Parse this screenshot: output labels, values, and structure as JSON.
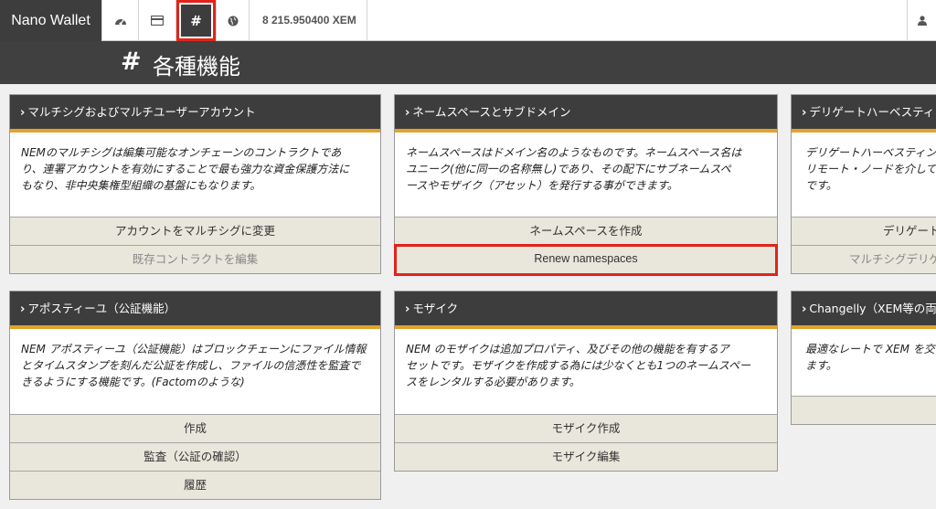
{
  "nav": {
    "brand": "Nano Wallet",
    "active_symbol": "#",
    "balance": "8 215.950400 XEM",
    "icons": [
      "dashboard-icon",
      "card-icon",
      "hash-icon",
      "globe-icon",
      "user-icon"
    ]
  },
  "page": {
    "title": "各種機能"
  },
  "panels": [
    {
      "title": "マルチシグおよびマルチユーザーアカウント",
      "lines": [
        "NEMのマルチシグは編集可能なオンチェーンのコントラクトであ",
        "り、連署アカウントを有効にすることで最も強力な資金保護方法に",
        "もなり、非中央集権型組織の基盤にもなります。"
      ],
      "buttons": [
        "アカウントをマルチシグに変更",
        "既存コントラクトを編集"
      ]
    },
    {
      "title": "ネームスペースとサブドメイン",
      "lines": [
        "ネームスペースはドメイン名のようなものです。ネームスペース名は",
        "ユニーク(他に同一の名称無し)であり、その配下にサブネームスペ",
        "ースやモザイク（アセット）を発行する事ができます。"
      ],
      "buttons": [
        "ネームスペースを作成",
        "Renew namespaces"
      ]
    },
    {
      "title": "デリゲートハーベスティング",
      "lines": [
        "デリゲートハーベスティングは",
        "リモート・ノードを介して「",
        "です。"
      ],
      "buttons": [
        "デリゲートア",
        "マルチシグデリゲ"
      ]
    },
    {
      "title": "アポスティーユ（公証機能）",
      "lines": [
        "NEM アポスティーユ（公証機能）はブロックチェーンにファイル情報",
        "とタイムスタンプを刻んだ公証を作成し、ファイルの信憑性を監査で",
        "きるようにする機能です。(Factomのような)"
      ],
      "buttons": [
        "作成",
        "監査（公証の確認）",
        "履歴"
      ]
    },
    {
      "title": "モザイク",
      "lines": [
        "NEM のモザイクは追加プロパティ、及びその他の機能を有するア",
        "セットです。モザイクを作成する為には少なくとも1つのネームスペー",
        "スをレンタルする必要があります。"
      ],
      "buttons": [
        "モザイク作成",
        "モザイク編集"
      ]
    },
    {
      "title": "Changelly（XEM等の両替",
      "lines": [
        "最適なレートで XEM を交",
        "ます。"
      ],
      "buttons": []
    }
  ]
}
